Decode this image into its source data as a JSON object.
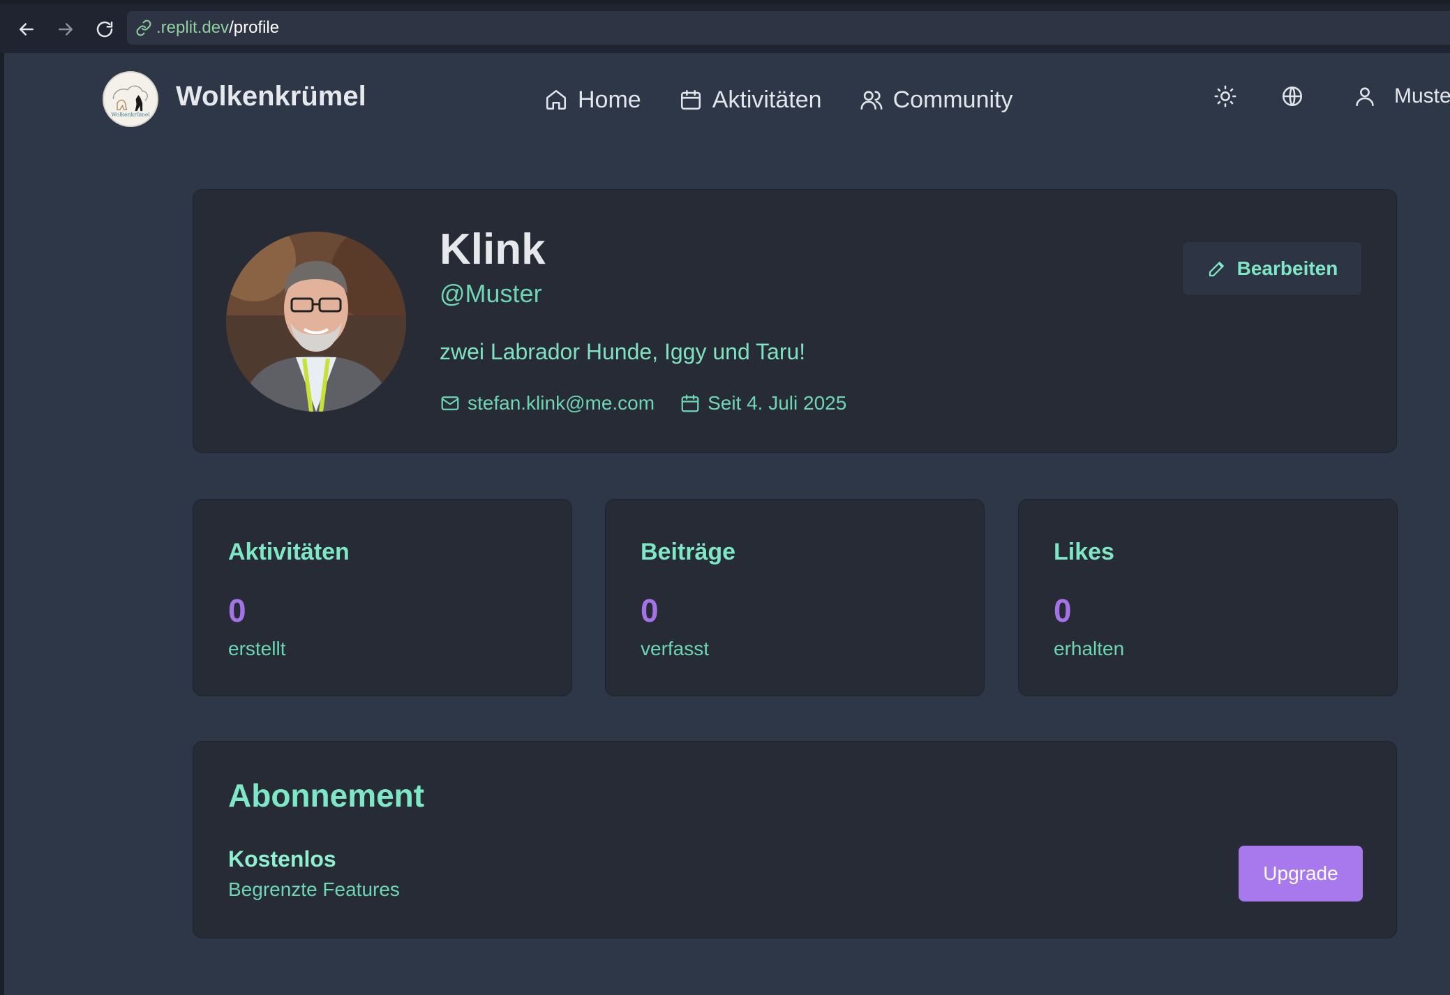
{
  "browser": {
    "url_host": ".replit.dev",
    "url_path": "/profile"
  },
  "header": {
    "brand": "Wolkenkrümel",
    "logo_text": "Wolkenkrümel",
    "nav": [
      {
        "label": "Home",
        "icon": "home-icon"
      },
      {
        "label": "Aktivitäten",
        "icon": "calendar-icon"
      },
      {
        "label": "Community",
        "icon": "users-icon"
      }
    ],
    "user_label": "Muste"
  },
  "profile": {
    "name": "Klink",
    "handle": "@Muster",
    "bio": "zwei Labrador Hunde, Iggy und Taru!",
    "email": "stefan.klink@me.com",
    "since": "Seit 4. Juli 2025",
    "edit_label": "Bearbeiten"
  },
  "stats": [
    {
      "title": "Aktivitäten",
      "value": "0",
      "sub": "erstellt"
    },
    {
      "title": "Beiträge",
      "value": "0",
      "sub": "verfasst"
    },
    {
      "title": "Likes",
      "value": "0",
      "sub": "erhalten"
    }
  ],
  "subscription": {
    "title": "Abonnement",
    "plan": "Kostenlos",
    "description": "Begrenzte Features",
    "upgrade_label": "Upgrade"
  },
  "colors": {
    "background": "#2d3748",
    "card": "#262b35",
    "accent_green": "#7ee8c6",
    "accent_purple": "#a779ec"
  }
}
